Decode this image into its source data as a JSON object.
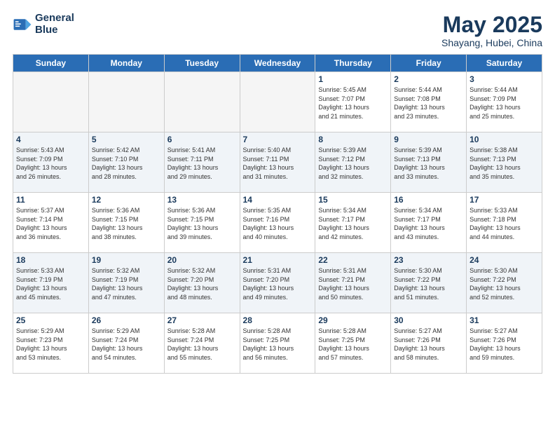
{
  "header": {
    "logo_line1": "General",
    "logo_line2": "Blue",
    "month": "May 2025",
    "location": "Shayang, Hubei, China"
  },
  "weekdays": [
    "Sunday",
    "Monday",
    "Tuesday",
    "Wednesday",
    "Thursday",
    "Friday",
    "Saturday"
  ],
  "weeks": [
    [
      {
        "day": "",
        "info": ""
      },
      {
        "day": "",
        "info": ""
      },
      {
        "day": "",
        "info": ""
      },
      {
        "day": "",
        "info": ""
      },
      {
        "day": "1",
        "info": "Sunrise: 5:45 AM\nSunset: 7:07 PM\nDaylight: 13 hours\nand 21 minutes."
      },
      {
        "day": "2",
        "info": "Sunrise: 5:44 AM\nSunset: 7:08 PM\nDaylight: 13 hours\nand 23 minutes."
      },
      {
        "day": "3",
        "info": "Sunrise: 5:44 AM\nSunset: 7:09 PM\nDaylight: 13 hours\nand 25 minutes."
      }
    ],
    [
      {
        "day": "4",
        "info": "Sunrise: 5:43 AM\nSunset: 7:09 PM\nDaylight: 13 hours\nand 26 minutes."
      },
      {
        "day": "5",
        "info": "Sunrise: 5:42 AM\nSunset: 7:10 PM\nDaylight: 13 hours\nand 28 minutes."
      },
      {
        "day": "6",
        "info": "Sunrise: 5:41 AM\nSunset: 7:11 PM\nDaylight: 13 hours\nand 29 minutes."
      },
      {
        "day": "7",
        "info": "Sunrise: 5:40 AM\nSunset: 7:11 PM\nDaylight: 13 hours\nand 31 minutes."
      },
      {
        "day": "8",
        "info": "Sunrise: 5:39 AM\nSunset: 7:12 PM\nDaylight: 13 hours\nand 32 minutes."
      },
      {
        "day": "9",
        "info": "Sunrise: 5:39 AM\nSunset: 7:13 PM\nDaylight: 13 hours\nand 33 minutes."
      },
      {
        "day": "10",
        "info": "Sunrise: 5:38 AM\nSunset: 7:13 PM\nDaylight: 13 hours\nand 35 minutes."
      }
    ],
    [
      {
        "day": "11",
        "info": "Sunrise: 5:37 AM\nSunset: 7:14 PM\nDaylight: 13 hours\nand 36 minutes."
      },
      {
        "day": "12",
        "info": "Sunrise: 5:36 AM\nSunset: 7:15 PM\nDaylight: 13 hours\nand 38 minutes."
      },
      {
        "day": "13",
        "info": "Sunrise: 5:36 AM\nSunset: 7:15 PM\nDaylight: 13 hours\nand 39 minutes."
      },
      {
        "day": "14",
        "info": "Sunrise: 5:35 AM\nSunset: 7:16 PM\nDaylight: 13 hours\nand 40 minutes."
      },
      {
        "day": "15",
        "info": "Sunrise: 5:34 AM\nSunset: 7:17 PM\nDaylight: 13 hours\nand 42 minutes."
      },
      {
        "day": "16",
        "info": "Sunrise: 5:34 AM\nSunset: 7:17 PM\nDaylight: 13 hours\nand 43 minutes."
      },
      {
        "day": "17",
        "info": "Sunrise: 5:33 AM\nSunset: 7:18 PM\nDaylight: 13 hours\nand 44 minutes."
      }
    ],
    [
      {
        "day": "18",
        "info": "Sunrise: 5:33 AM\nSunset: 7:19 PM\nDaylight: 13 hours\nand 45 minutes."
      },
      {
        "day": "19",
        "info": "Sunrise: 5:32 AM\nSunset: 7:19 PM\nDaylight: 13 hours\nand 47 minutes."
      },
      {
        "day": "20",
        "info": "Sunrise: 5:32 AM\nSunset: 7:20 PM\nDaylight: 13 hours\nand 48 minutes."
      },
      {
        "day": "21",
        "info": "Sunrise: 5:31 AM\nSunset: 7:20 PM\nDaylight: 13 hours\nand 49 minutes."
      },
      {
        "day": "22",
        "info": "Sunrise: 5:31 AM\nSunset: 7:21 PM\nDaylight: 13 hours\nand 50 minutes."
      },
      {
        "day": "23",
        "info": "Sunrise: 5:30 AM\nSunset: 7:22 PM\nDaylight: 13 hours\nand 51 minutes."
      },
      {
        "day": "24",
        "info": "Sunrise: 5:30 AM\nSunset: 7:22 PM\nDaylight: 13 hours\nand 52 minutes."
      }
    ],
    [
      {
        "day": "25",
        "info": "Sunrise: 5:29 AM\nSunset: 7:23 PM\nDaylight: 13 hours\nand 53 minutes."
      },
      {
        "day": "26",
        "info": "Sunrise: 5:29 AM\nSunset: 7:24 PM\nDaylight: 13 hours\nand 54 minutes."
      },
      {
        "day": "27",
        "info": "Sunrise: 5:28 AM\nSunset: 7:24 PM\nDaylight: 13 hours\nand 55 minutes."
      },
      {
        "day": "28",
        "info": "Sunrise: 5:28 AM\nSunset: 7:25 PM\nDaylight: 13 hours\nand 56 minutes."
      },
      {
        "day": "29",
        "info": "Sunrise: 5:28 AM\nSunset: 7:25 PM\nDaylight: 13 hours\nand 57 minutes."
      },
      {
        "day": "30",
        "info": "Sunrise: 5:27 AM\nSunset: 7:26 PM\nDaylight: 13 hours\nand 58 minutes."
      },
      {
        "day": "31",
        "info": "Sunrise: 5:27 AM\nSunset: 7:26 PM\nDaylight: 13 hours\nand 59 minutes."
      }
    ]
  ]
}
